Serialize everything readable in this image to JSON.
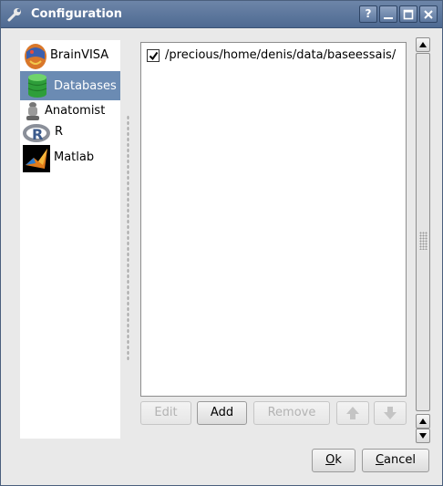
{
  "window": {
    "title": "Configuration",
    "title_icon": "wrench-icon",
    "controls": {
      "help": "?",
      "minimize_icon": "minimize-icon",
      "maximize_icon": "maximize-icon",
      "close_icon": "close-icon"
    }
  },
  "sidebar": {
    "items": [
      {
        "label": "BrainVISA",
        "icon": "brainvisa-logo-icon",
        "selected": false
      },
      {
        "label": "Databases",
        "icon": "database-icon",
        "selected": true
      },
      {
        "label": "Anatomist",
        "icon": "anatomist-icon",
        "selected": false
      },
      {
        "label": "R",
        "icon": "r-logo-icon",
        "selected": false
      },
      {
        "label": "Matlab",
        "icon": "matlab-logo-icon",
        "selected": false
      }
    ]
  },
  "databases": {
    "entries": [
      {
        "path": "/precious/home/denis/data/baseessais/",
        "checked": true
      }
    ]
  },
  "actions": {
    "edit": "Edit",
    "add": "Add",
    "remove": "Remove",
    "move_up_icon": "arrow-up-icon",
    "move_down_icon": "arrow-down-icon"
  },
  "dialog": {
    "ok_prefix": "",
    "ok_mnemonic": "O",
    "ok_rest": "k",
    "cancel_prefix": "",
    "cancel_mnemonic": "C",
    "cancel_rest": "ancel"
  }
}
